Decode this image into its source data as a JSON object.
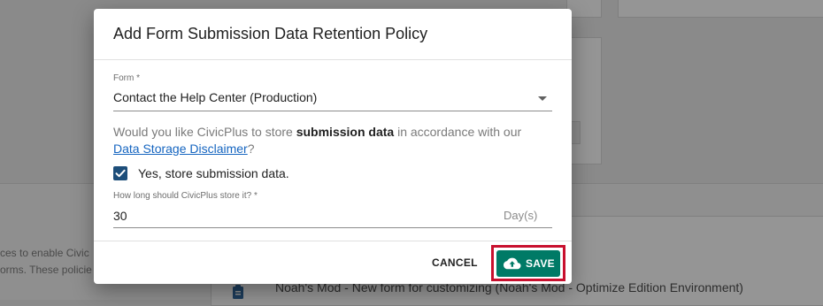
{
  "background": {
    "left_text_line1": "ces to enable Civic",
    "left_text_line2": "orms. These policie",
    "row_text": "Noah's Mod - New form for customizing (Noah's Mod - Optimize Edition Environment)"
  },
  "dialog": {
    "title": "Add Form Submission Data Retention Policy",
    "form_field": {
      "label": "Form *",
      "value": "Contact the Help Center (Production)"
    },
    "question": {
      "prefix": "Would you like CivicPlus to store ",
      "bold": "submission data",
      "middle": " in accordance with our",
      "link": "Data Storage Disclaimer",
      "suffix": "?"
    },
    "checkbox": {
      "label": "Yes, store submission data.",
      "checked": true
    },
    "retention_field": {
      "label": "How long should CivicPlus store it? *",
      "value": "30",
      "suffix": "Day(s)"
    },
    "buttons": {
      "cancel": "CANCEL",
      "save": "SAVE"
    }
  },
  "colors": {
    "primary": "#007a66",
    "checkbox": "#1d4e7a",
    "link": "#1565c0",
    "highlight": "#c8102e"
  },
  "icons": {
    "save": "cloud-upload-icon",
    "checkbox": "check-icon",
    "dropdown": "chevron-down-icon",
    "row": "clipboard-icon"
  }
}
